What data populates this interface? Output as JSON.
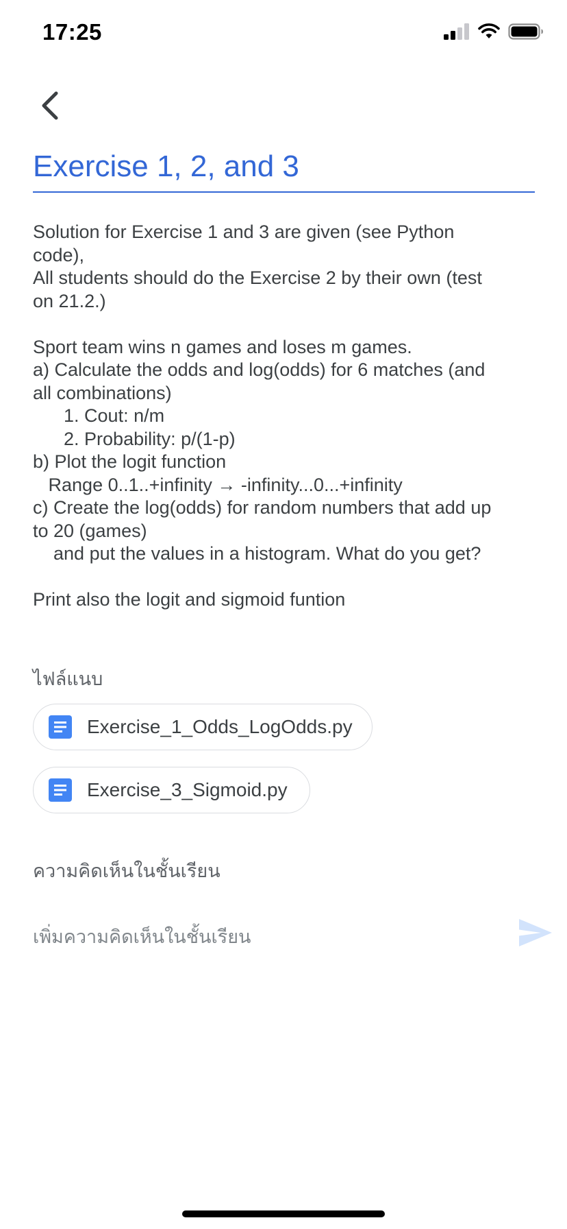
{
  "status_bar": {
    "time": "17:25"
  },
  "assignment": {
    "title": "Exercise 1, 2, and 3",
    "description": "Solution for Exercise 1 and 3 are given (see Python\ncode),\nAll students should do the Exercise 2 by their own (test\non 21.2.)\n\nSport team wins n games and loses m games.\na) Calculate the odds and log(odds) for 6 matches (and\nall combinations)\n      1. Cout: n/m\n      2. Probability: p/(1-p)\nb) Plot the logit function\n   Range 0..1..+infinity → -infinity...0...+infinity\nc) Create the log(odds) for random numbers that add up\nto 20 (games)\n    and put the values in a histogram. What do you get?\n\nPrint also the logit and sigmoid funtion"
  },
  "attachments": {
    "label": "ไฟล์แนบ",
    "files": [
      {
        "name": "Exercise_1_Odds_LogOdds.py",
        "icon": "google-doc-icon"
      },
      {
        "name": "Exercise_3_Sigmoid.py",
        "icon": "google-doc-icon"
      }
    ]
  },
  "comments": {
    "label": "ความคิดเห็นในชั้นเรียน",
    "input_placeholder": "เพิ่มความคิดเห็นในชั้นเรียน",
    "send_icon": "send-icon"
  },
  "colors": {
    "accent": "#3367d6",
    "doc_icon": "#4285f4",
    "send_disabled": "#d2e3fc"
  }
}
